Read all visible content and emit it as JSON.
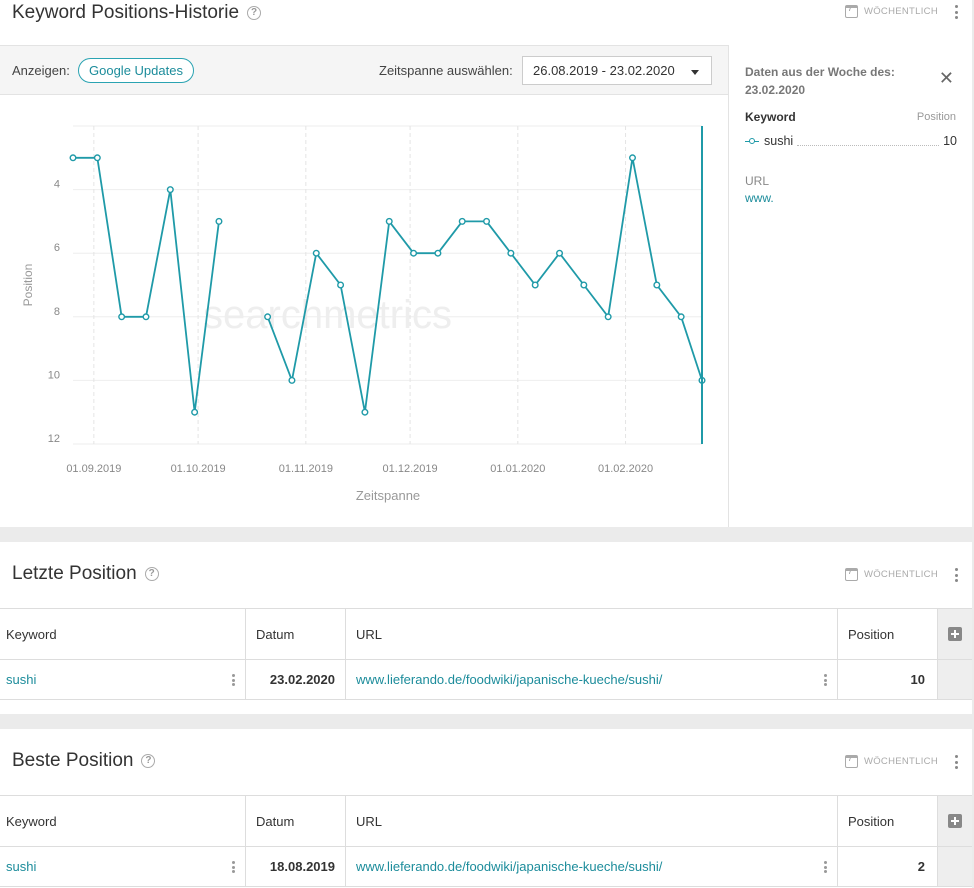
{
  "history": {
    "title": "Keyword Positions-Historie",
    "help": "?",
    "weekly": "WÖCHENTLICH",
    "show_label": "Anzeigen:",
    "google_updates": "Google Updates",
    "range_label": "Zeitspanne auswählen:",
    "range_value": "26.08.2019 - 23.02.2020",
    "side": {
      "title": "Daten aus der Woche des: 23.02.2020",
      "close": "✕",
      "keyword_header": "Keyword",
      "position_header": "Position",
      "keyword": "sushi",
      "position": "10",
      "url_header": "URL",
      "url": "www."
    }
  },
  "chart_data": {
    "type": "line",
    "ylabel": "Position",
    "xlabel": "Zeitspanne",
    "y_inverted": true,
    "ylim": [
      2,
      12
    ],
    "yticks": [
      4,
      6,
      8,
      10,
      12
    ],
    "xlim": [
      "2019-08-26",
      "2020-02-23"
    ],
    "xticks": [
      "01.09.2019",
      "01.10.2019",
      "01.11.2019",
      "01.12.2019",
      "01.01.2020",
      "01.02.2020"
    ],
    "xtick_dates": [
      "2019-09-01",
      "2019-10-01",
      "2019-11-01",
      "2019-12-01",
      "2020-01-01",
      "2020-02-01"
    ],
    "watermark": "searchmetrics",
    "series": [
      {
        "name": "sushi",
        "color": "#1f9aa8",
        "x": [
          "2019-08-26",
          "2019-09-02",
          "2019-09-09",
          "2019-09-16",
          "2019-09-23",
          "2019-09-30",
          "2019-10-07",
          "2019-10-14",
          "2019-10-21",
          "2019-10-28",
          "2019-11-04",
          "2019-11-11",
          "2019-11-18",
          "2019-11-25",
          "2019-12-02",
          "2019-12-09",
          "2019-12-16",
          "2019-12-23",
          "2019-12-30",
          "2020-01-06",
          "2020-01-13",
          "2020-01-20",
          "2020-01-27",
          "2020-02-03",
          "2020-02-10",
          "2020-02-17",
          "2020-02-23"
        ],
        "y": [
          3,
          3,
          8,
          8,
          4,
          11,
          5,
          null,
          8,
          10,
          6,
          7,
          11,
          5,
          6,
          6,
          5,
          5,
          6,
          7,
          6,
          7,
          8,
          3,
          7,
          8,
          10
        ]
      }
    ]
  },
  "latest": {
    "title": "Letzte Position",
    "help": "?",
    "weekly": "WÖCHENTLICH",
    "headers": {
      "keyword": "Keyword",
      "date": "Datum",
      "url": "URL",
      "position": "Position"
    },
    "row": {
      "keyword": "sushi",
      "date": "23.02.2020",
      "url": "www.lieferando.de/foodwiki/japanische-kueche/sushi/",
      "position": "10"
    }
  },
  "best": {
    "title": "Beste Position",
    "help": "?",
    "weekly": "WÖCHENTLICH",
    "headers": {
      "keyword": "Keyword",
      "date": "Datum",
      "url": "URL",
      "position": "Position"
    },
    "row": {
      "keyword": "sushi",
      "date": "18.08.2019",
      "url": "www.lieferando.de/foodwiki/japanische-kueche/sushi/",
      "position": "2"
    }
  }
}
